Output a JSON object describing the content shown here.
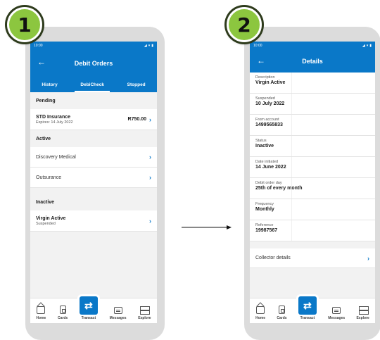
{
  "steps": [
    "1",
    "2"
  ],
  "status_time": "10:00",
  "screen1": {
    "title": "Debit Orders",
    "tabs": [
      "History",
      "DebiCheck",
      "Stopped"
    ],
    "active_tab": "DebiCheck",
    "pending": {
      "heading": "Pending",
      "items": [
        {
          "name": "STD Insurance",
          "sub": "Expires: 14 July 2022",
          "amount": "R750.00"
        }
      ]
    },
    "active": {
      "heading": "Active",
      "items": [
        "Discovery Medical",
        "Outsurance"
      ]
    },
    "inactive": {
      "heading": "Inactive",
      "items": [
        {
          "name": "Virgin Active",
          "sub": "Suspended"
        }
      ]
    }
  },
  "screen2": {
    "title": "Details",
    "fields": [
      {
        "label": "Description",
        "value": "Virgin Active"
      },
      {
        "label": "Suspended",
        "value": "10 July 2022"
      },
      {
        "label": "From account",
        "value": "1499565833"
      },
      {
        "label": "Status",
        "value": "Inactive"
      },
      {
        "label": "Date initiated",
        "value": "14 June 2022"
      },
      {
        "label": "Debit order day",
        "value": "25th of every month"
      },
      {
        "label": "Frequency",
        "value": "Monthly"
      },
      {
        "label": "Reference",
        "value": "19987567"
      }
    ],
    "collector_label": "Collector details"
  },
  "bottom_nav": [
    "Home",
    "Cards",
    "Transact",
    "Messages",
    "Explore"
  ],
  "colors": {
    "brand_blue": "#0a78c8",
    "badge_green": "#8cc63f"
  }
}
